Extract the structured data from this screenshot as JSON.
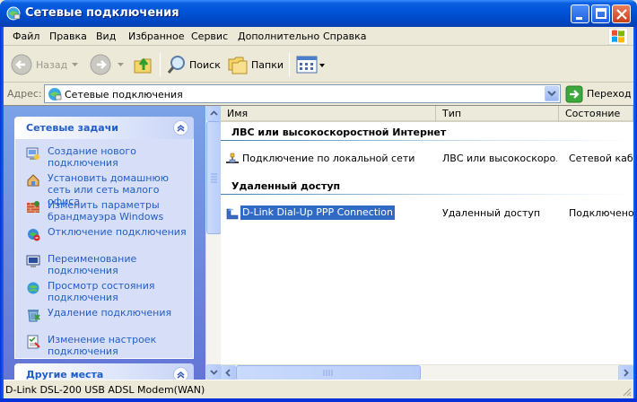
{
  "window": {
    "title": "Сетевые подключения"
  },
  "menu": {
    "items": [
      "Файл",
      "Правка",
      "Вид",
      "Избранное",
      "Сервис",
      "Дополнительно",
      "Справка"
    ]
  },
  "toolbar": {
    "back_label": "Назад",
    "search_label": "Поиск",
    "folders_label": "Папки"
  },
  "address": {
    "label": "Адрес:",
    "value": "Сетевые подключения",
    "go_label": "Переход"
  },
  "task_pane": {
    "network_tasks_title": "Сетевые задачи",
    "tasks": [
      {
        "label": "Создание нового подключения",
        "icon": "new-connection-icon"
      },
      {
        "label": "Установить домашнюю сеть или сеть малого офиса",
        "icon": "home-network-icon"
      },
      {
        "label": "Изменить параметры брандмауэра Windows",
        "icon": "firewall-icon"
      },
      {
        "label": "Отключение подключения",
        "icon": "disconnect-icon"
      },
      {
        "label": "Переименование подключения",
        "icon": "rename-icon"
      },
      {
        "label": "Просмотр состояния подключения",
        "icon": "status-icon"
      },
      {
        "label": "Удаление подключения",
        "icon": "delete-icon"
      },
      {
        "label": "Изменение настроек подключения",
        "icon": "settings-icon"
      }
    ],
    "other_places_title": "Другие места"
  },
  "list": {
    "columns": [
      "Имя",
      "Тип",
      "Состояние"
    ],
    "groups": [
      {
        "title": "ЛВС или высокоскоростной Интернет",
        "rows": [
          {
            "name": "Подключение по локальной сети",
            "type": "ЛВС или высокоскоро...",
            "state": "Сетевой кабе..."
          }
        ]
      },
      {
        "title": "Удаленный доступ",
        "rows": [
          {
            "name": "D-Link Dial-Up PPP Connection",
            "type": "Удаленный доступ",
            "state": "Подключено,"
          }
        ]
      }
    ]
  },
  "status_bar": {
    "text": "D-Link DSL-200 USB ADSL Modem(WAN)"
  },
  "colors": {
    "title_blue": "#0052D6",
    "task_link": "#215DC6",
    "selection": "#316AC5"
  }
}
